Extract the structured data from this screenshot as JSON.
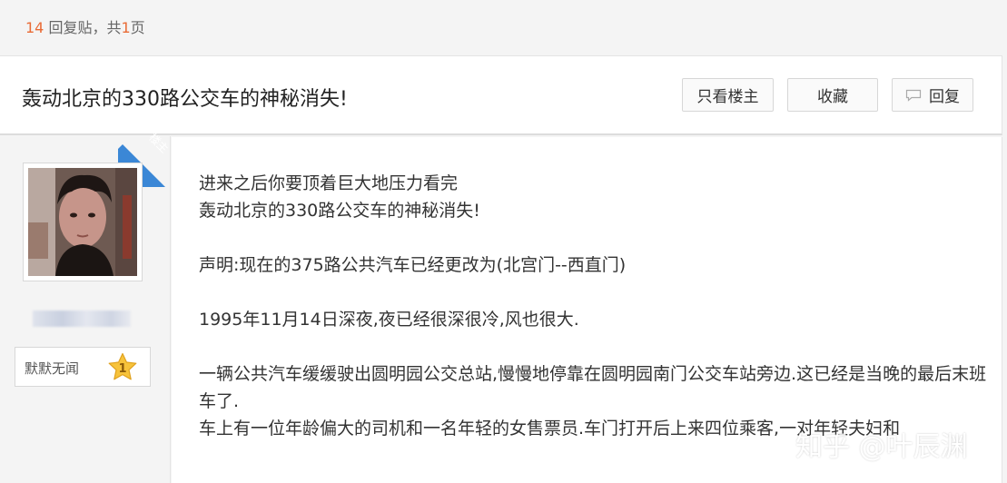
{
  "header": {
    "reply_count": "14",
    "reply_label": " 回复贴，共",
    "page_count": "1",
    "page_label": "页"
  },
  "thread": {
    "title": "轰动北京的330路公交车的神秘消失!",
    "btn_louzhu": "只看楼主",
    "btn_favorite": "收藏",
    "btn_reply": "回复"
  },
  "author": {
    "badge": "楼主",
    "level_name": "默默无闻",
    "level": "1"
  },
  "post": {
    "lines": [
      "进来之后你要顶着巨大地压力看完",
      "轰动北京的330路公交车的神秘消失!",
      "",
      "声明:现在的375路公共汽车已经更改为(北宫门--西直门)",
      "",
      "1995年11月14日深夜,夜已经很深很冷,风也很大.",
      "",
      "一辆公共汽车缓缓驶出圆明园公交总站,慢慢地停靠在圆明园南门公交车站旁边.这已经是当晚的最后末班车了.",
      "车上有一位年龄偏大的司机和一名年轻的女售票员.车门打开后上来四位乘客,一对年轻夫妇和"
    ]
  },
  "watermark": "知乎 @叶辰渊",
  "colors": {
    "accent": "#e96b36",
    "badge_blue": "#3b87d6"
  }
}
